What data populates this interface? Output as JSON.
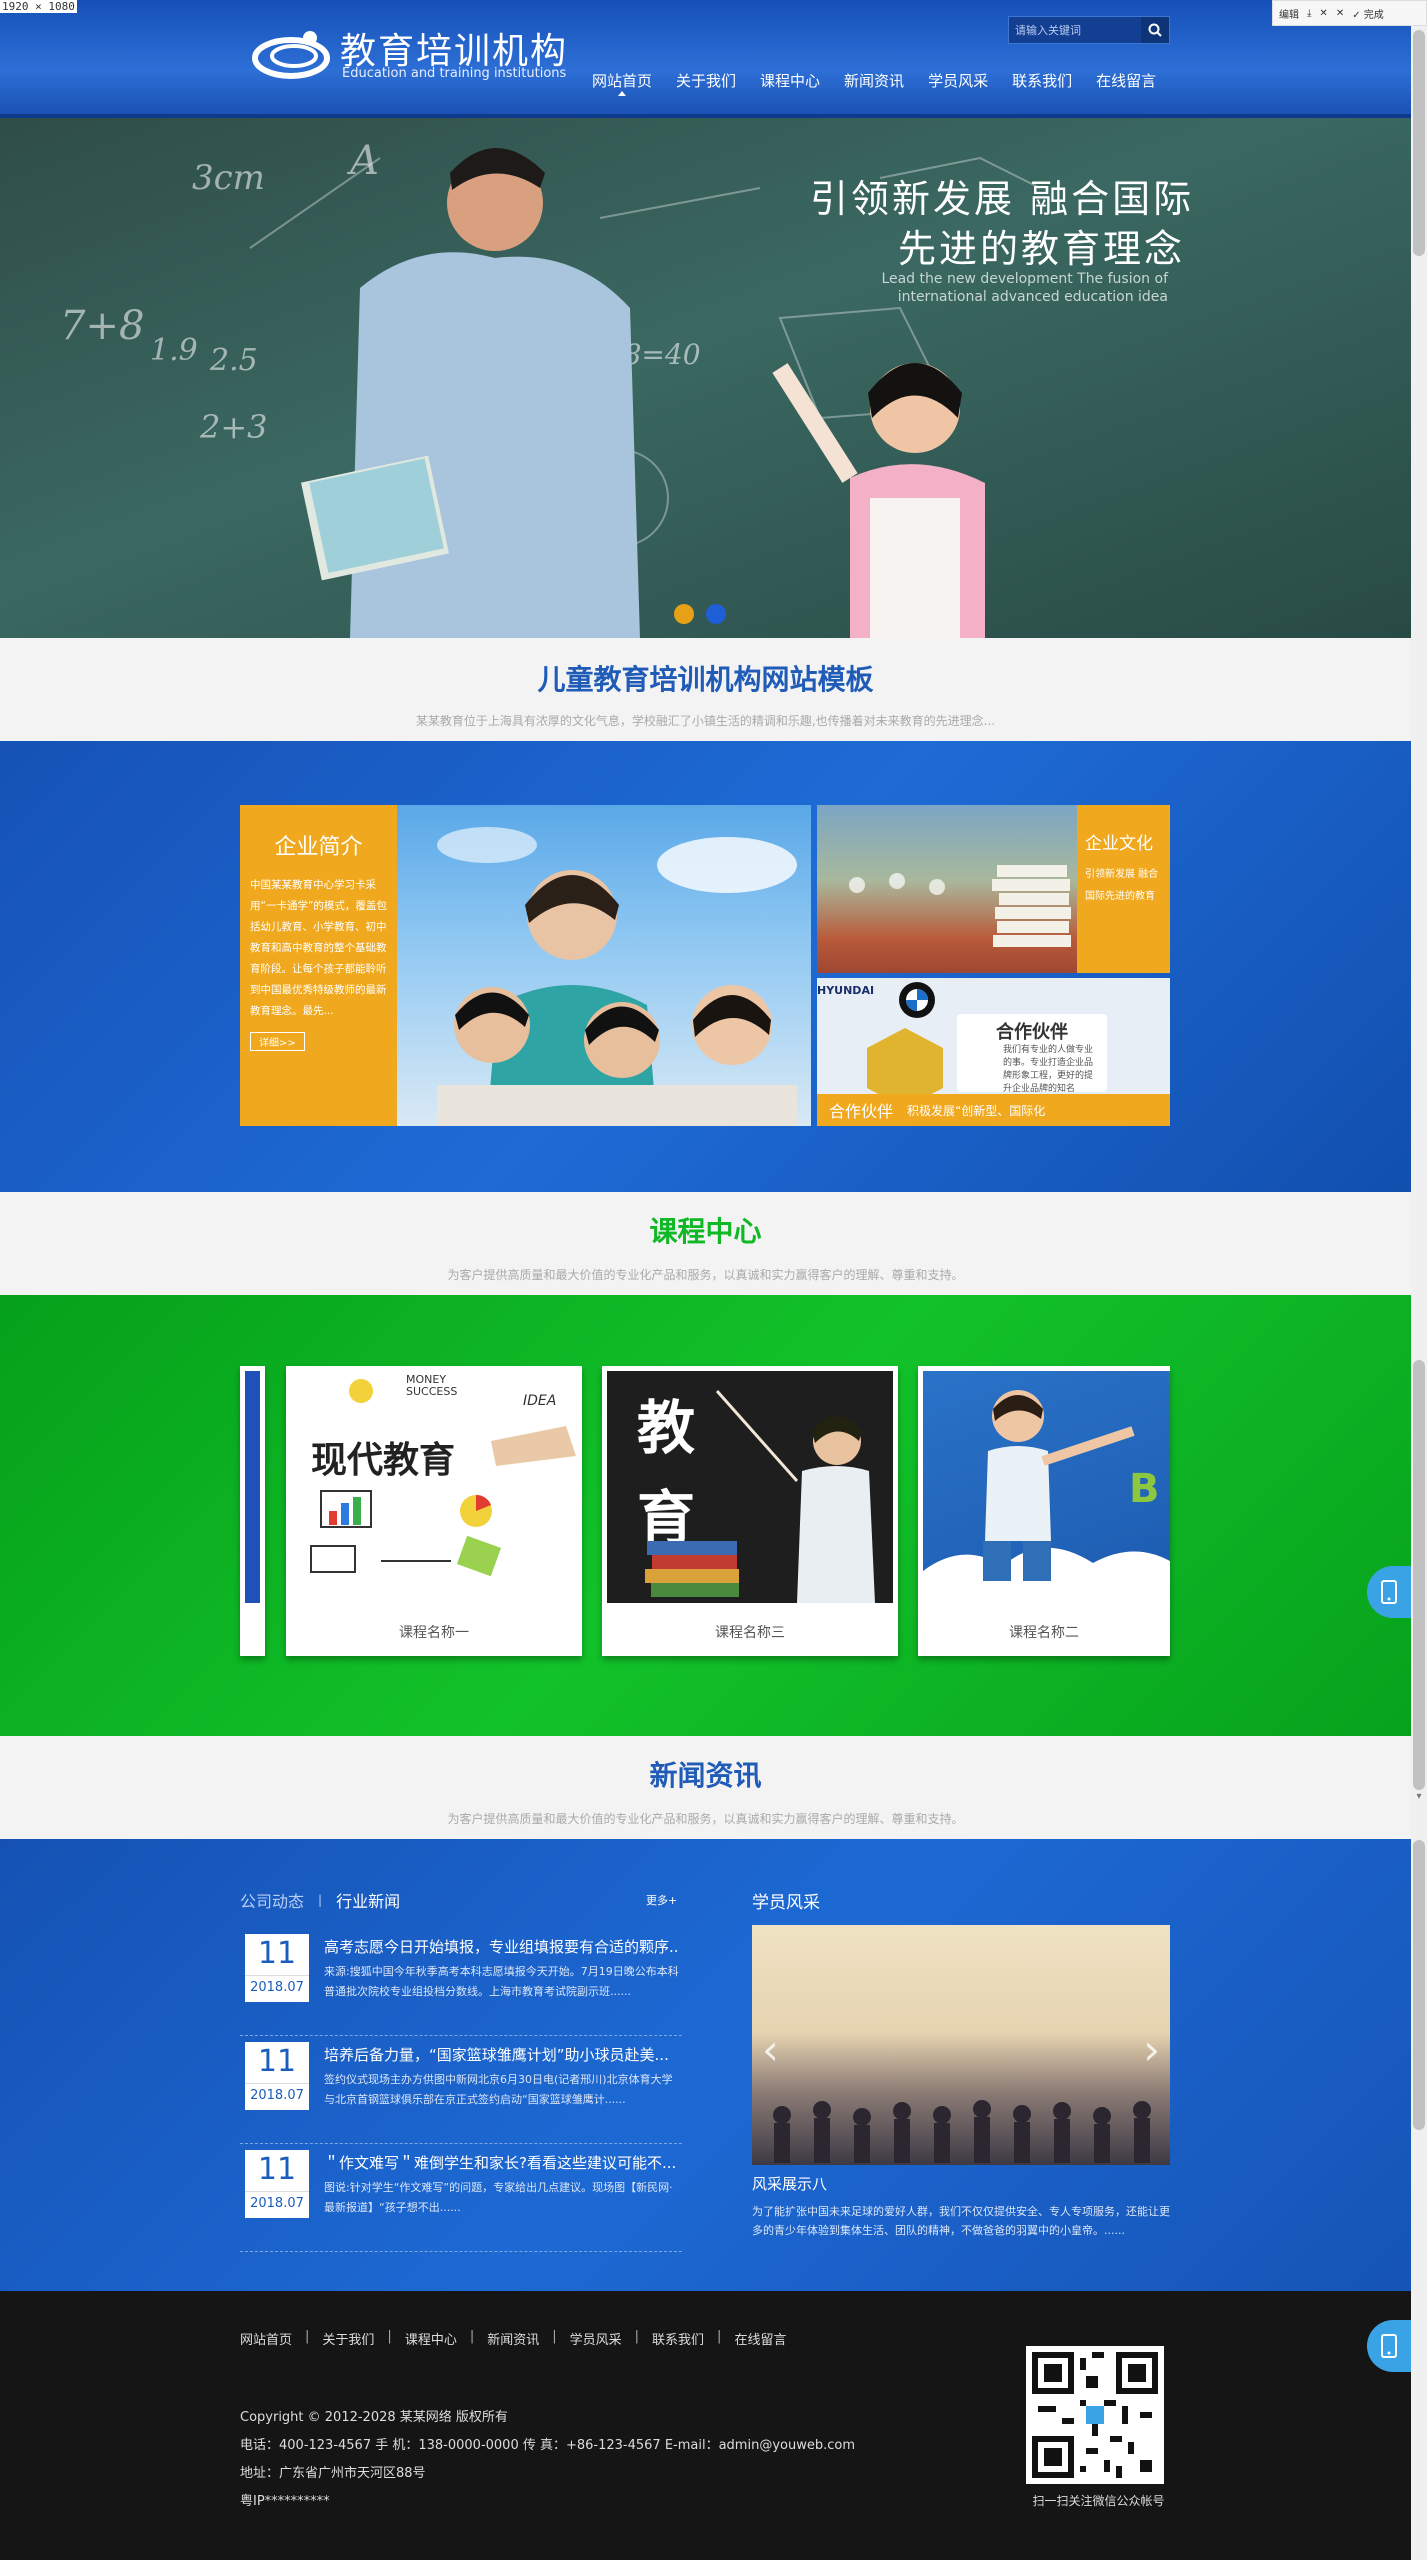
{
  "screen_dims": "1920 × 1080",
  "toolbar": {
    "edit": "编辑",
    "done": "完成"
  },
  "header": {
    "logo_cn": "教育培训机构",
    "logo_en": "Education and training institutions",
    "search_placeholder": "请输入关键词",
    "nav": [
      "网站首页",
      "关于我们",
      "课程中心",
      "新闻资讯",
      "学员风采",
      "联系我们",
      "在线留言"
    ],
    "active_nav": "网站首页"
  },
  "banner": {
    "slogan_line1": "引领新发展 融合国际",
    "slogan_line2": "先进的教育理念",
    "slogan_en": "Lead the new development The fusion of international advanced education idea",
    "chalk": [
      "7+8",
      "2+3",
      "5x8=40",
      "2.5",
      "1.9",
      "3cm",
      "A"
    ],
    "dot_colors": [
      "#e6a117",
      "#1e5ed6"
    ]
  },
  "intro": {
    "title": "儿童教育培训机构网站模板",
    "subtitle": "某某教育位于上海具有浓厚的文化气息，学校融汇了小镇生活的精调和乐趣,也传播着对未来教育的先进理念..."
  },
  "about": {
    "title": "企业简介",
    "text": "中国某某教育中心学习卡采用“一卡通学”的模式，覆盖包括幼儿教育、小学教育、初中教育和高中教育的整个基础教育阶段。让每个孩子都能聆听到中国最优秀特级教师的最新教育理念。最先...",
    "more": "详细>>",
    "culture_title": "企业文化",
    "culture_text": "引领新发展 融合国际先进的教育",
    "partner_card_title": "合作伙伴",
    "partner_card_text": "我们有专业的人做专业的事。专业打造企业品牌形象工程，更好的提升企业品牌的知名",
    "partner_bar_title": "合作伙伴",
    "partner_bar_text": "积极发展“创新型、国际化",
    "partner_brand": "HYUNDAI"
  },
  "courses": {
    "title": "课程中心",
    "subtitle": "为客户提供高质量和最大价值的专业化产品和服务，以真诚和实力赢得客户的理解、尊重和支持。",
    "items": [
      {
        "label": "课程名称一",
        "image_text": "现代教育",
        "image_small": [
          "MONEY",
          "SUCCESS",
          "IDEA"
        ]
      },
      {
        "label": "课程名称三",
        "image_text_1": "教",
        "image_text_2": "育"
      },
      {
        "label": "课程名称二",
        "image_text": "B"
      }
    ]
  },
  "news": {
    "title": "新闻资讯",
    "subtitle": "为客户提供高质量和最大价值的专业化产品和服务，以真诚和实力赢得客户的理解、尊重和支持。",
    "tab_company": "公司动态",
    "tab_sep": "|",
    "tab_industry": "行业新闻",
    "more": "更多+",
    "items": [
      {
        "day": "11",
        "ym": "2018.07",
        "title": "高考志愿今日开始填报，专业组填报要有合适的颗序...",
        "desc": "来源:搜狐中国今年秋季高考本科志愿填报今天开始。7月19日晚公布本科普通批次院校专业组投档分数线。上海市教育考试院副示班......"
      },
      {
        "day": "11",
        "ym": "2018.07",
        "title": "培养后备力量，“国家篮球雏鹰计划”助小球员赴美...",
        "desc": "签约仪式现场主办方供图中新网北京6月30日电(记者邢川)北京体育大学与北京首钢篮球俱乐部在京正式签约启动“国家篮球雏鹰计......"
      },
      {
        "day": "11",
        "ym": "2018.07",
        "title": "＂作文难写＂难倒学生和家长?看看这些建议可能不...",
        "desc": "图说:针对学生“作文难写”的问题，专家给出几点建议。现场图【新民网·最新报道】“孩子想不出......"
      }
    ],
    "style_title": "学员风采",
    "style_caption": "风采展示八",
    "style_desc": "为了能扩张中国未来足球的爱好人群，我们不仅仅提供安全、专人专项服务，还能让更多的青少年体验到集体生活、团队的精神，不做爸爸的羽翼中的小皇帝。......",
    "arrow_left": "‹",
    "arrow_right": "›"
  },
  "footer": {
    "links": [
      "网站首页",
      "关于我们",
      "课程中心",
      "新闻资讯",
      "学员风采",
      "联系我们",
      "在线留言"
    ],
    "link_sep": "|",
    "copyright": "Copyright © 2012-2028 某某网络 版权所有",
    "contact": "电话：400-123-4567 手 机：138-0000-0000 传 真：+86-123-4567 E-mail：admin@youweb.com",
    "address": "地址：广东省广州市天河区88号",
    "icp": "粤IP**********",
    "qr_caption": "扫一扫关注微信公众帐号"
  },
  "colors": {
    "blue": "#1d62cc",
    "green": "#0fb825",
    "orange": "#f0a91f",
    "title_blue": "#1f5bb7",
    "title_green": "#0fb825",
    "footer": "#151515"
  }
}
